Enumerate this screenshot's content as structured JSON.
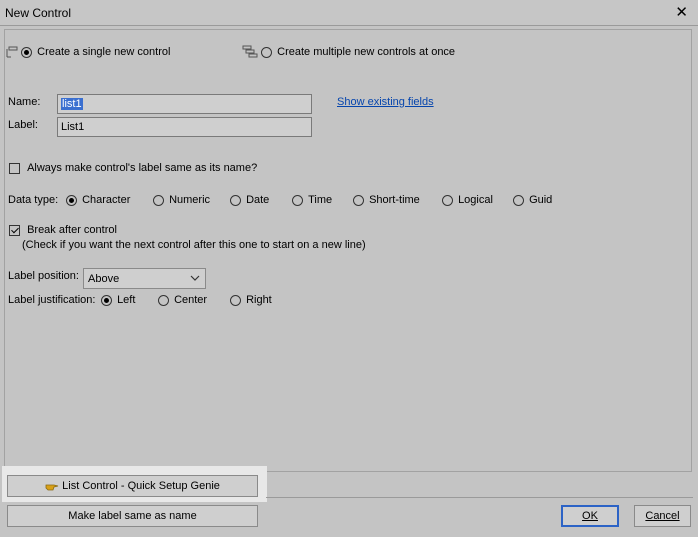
{
  "window": {
    "title": "New Control",
    "close_glyph": "✕"
  },
  "mode": {
    "single_label": "Create a single new control",
    "multiple_label": "Create multiple new controls at once",
    "selected": "single",
    "single_icon": "single-control-icon",
    "multiple_icon": "multiple-controls-icon"
  },
  "fields": {
    "name_label": "Name:",
    "name_value": "list1",
    "label_label": "Label:",
    "label_value": "List1",
    "show_existing_link": "Show existing fields"
  },
  "always_same": {
    "label": "Always make control's label same as its name?",
    "checked": false
  },
  "data_type": {
    "label": "Data type:",
    "options": [
      "Character",
      "Numeric",
      "Date",
      "Time",
      "Short-time",
      "Logical",
      "Guid"
    ],
    "selected": "Character"
  },
  "break_after": {
    "label": "Break after control",
    "hint": "(Check if you want the next control after this one to start on a new line)",
    "checked": true
  },
  "label_position": {
    "label": "Label position:",
    "value": "Above"
  },
  "label_justification": {
    "label": "Label justification:",
    "options": [
      "Left",
      "Center",
      "Right"
    ],
    "selected": "Left"
  },
  "buttons": {
    "genie": "List Control - Quick Setup Genie",
    "genie_icon": "pointing-hand-icon",
    "make_label": "Make label same as name",
    "ok": "OK",
    "cancel": "Cancel"
  },
  "colors": {
    "link": "#0645ad",
    "selection": "#3a6fd0",
    "focus_border": "#2c63c6"
  }
}
